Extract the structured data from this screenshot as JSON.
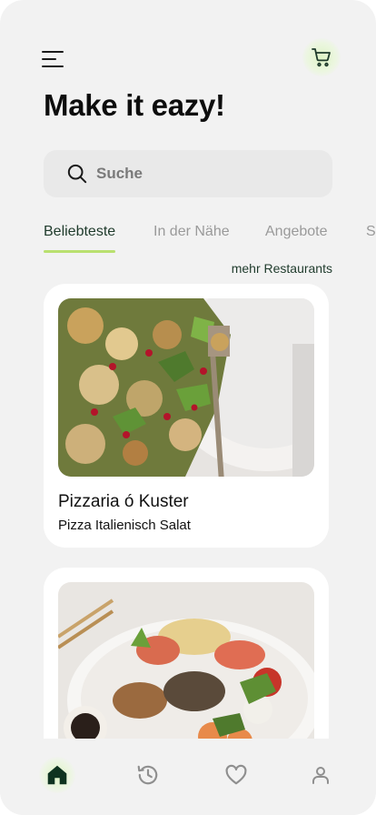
{
  "header": {
    "menu_icon": "hamburger-menu-icon",
    "cart_icon": "cart-icon",
    "title": "Make it eazy!"
  },
  "search": {
    "placeholder": "Suche",
    "icon": "search-icon"
  },
  "tabs": [
    {
      "label": "Beliebteste",
      "active": true
    },
    {
      "label": "In der Nähe",
      "active": false
    },
    {
      "label": "Angebote",
      "active": false
    },
    {
      "label": "S",
      "active": false
    }
  ],
  "more_link": "mehr Restaurants",
  "restaurants": [
    {
      "name": "Pizzaria ó Kuster",
      "subtitle": "Pizza Italienisch Salat",
      "image": "cauliflower-salad-photo"
    },
    {
      "name": "",
      "subtitle": "",
      "image": "sushi-platter-photo"
    }
  ],
  "bottom_nav": [
    {
      "icon": "home-icon",
      "active": true
    },
    {
      "icon": "history-icon",
      "active": false
    },
    {
      "icon": "heart-icon",
      "active": false
    },
    {
      "icon": "user-icon",
      "active": false
    }
  ],
  "colors": {
    "accent": "#b9e06f",
    "dark_green": "#1f3b2c",
    "background": "#f2f2f2",
    "card": "#ffffff"
  }
}
